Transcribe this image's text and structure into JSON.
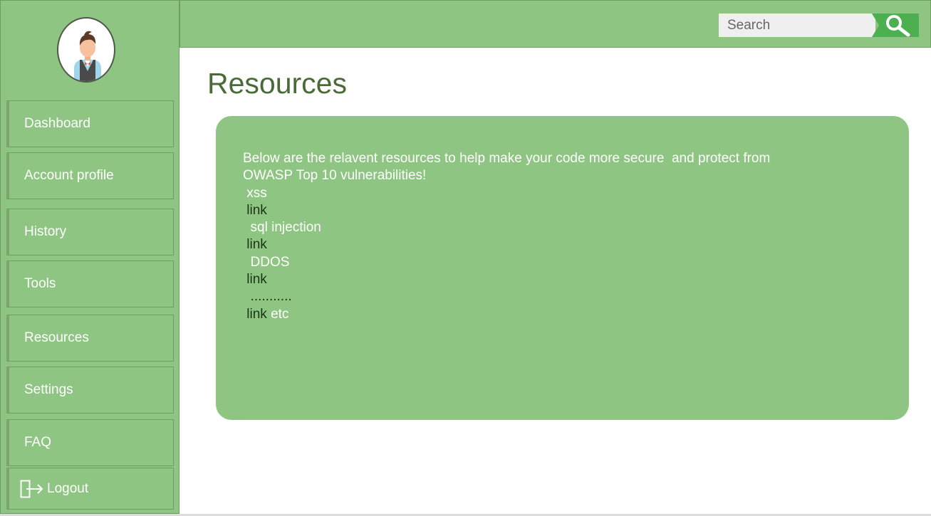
{
  "sidebar": {
    "items": [
      {
        "label": "Dashboard"
      },
      {
        "label": "Account profile"
      },
      {
        "label": "History"
      },
      {
        "label": "Tools"
      },
      {
        "label": "Resources"
      },
      {
        "label": "Settings"
      },
      {
        "label": "FAQ"
      },
      {
        "label": "Logout",
        "icon": "logout-icon"
      }
    ]
  },
  "header": {
    "search_placeholder": "Search",
    "search_icon": "search-icon"
  },
  "main": {
    "title": "Resources",
    "intro_line1": "Below are the relavent resources to help make your code more secure  and protect from",
    "intro_line2": "OWASP Top 10 vulnerabilities!",
    "resources": [
      {
        "name": " xss",
        "link": "link"
      },
      {
        "name": "  sql injection",
        "link": "link"
      },
      {
        "name": "  DDOS",
        "link": "link"
      },
      {
        "name": "  ...........",
        "link": "link",
        "suffix": " etc"
      }
    ]
  },
  "colors": {
    "accent_green": "#8fc582",
    "search_button": "#4caf50",
    "title": "#4a6b38",
    "link": "#1a3514"
  }
}
